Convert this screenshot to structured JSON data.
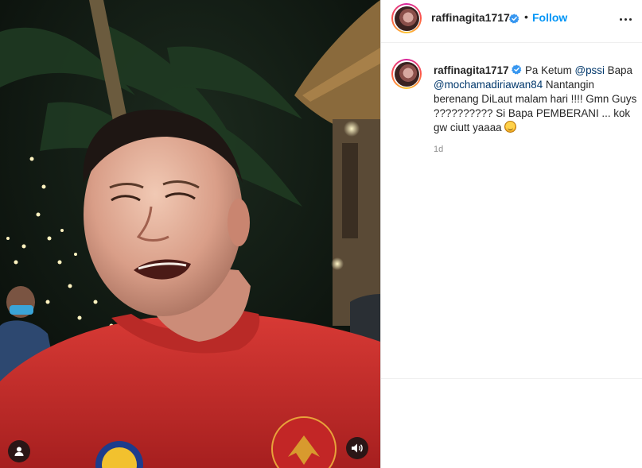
{
  "post": {
    "username": "raffinagita1717",
    "follow_label": "Follow",
    "header_separator": "•"
  },
  "caption": {
    "username": "raffinagita1717",
    "text_1": " Pa Ketum ",
    "mention_1": "@pssi",
    "text_2": " Bapa ",
    "mention_2": "@mochamadiriawan84",
    "text_3": " Nantangin berenang DiLaut malam hari !!!! Gmn Guys ?????????? Si Bapa PEMBERANI ... kok gw ciutt yaaaa ",
    "emoji": "smiling-face-with-halo-emoji",
    "timestamp": "1d"
  },
  "media": {
    "type": "video",
    "controls": {
      "tag_icon": "user-tag-icon",
      "audio_icon": "speaker-icon"
    }
  },
  "colors": {
    "accent_blue": "#0095f6",
    "mention_blue": "#00376b",
    "verified_blue": "#3897f0",
    "secondary_text": "#8e8e8e",
    "jersey_red": "#c72a2a"
  }
}
